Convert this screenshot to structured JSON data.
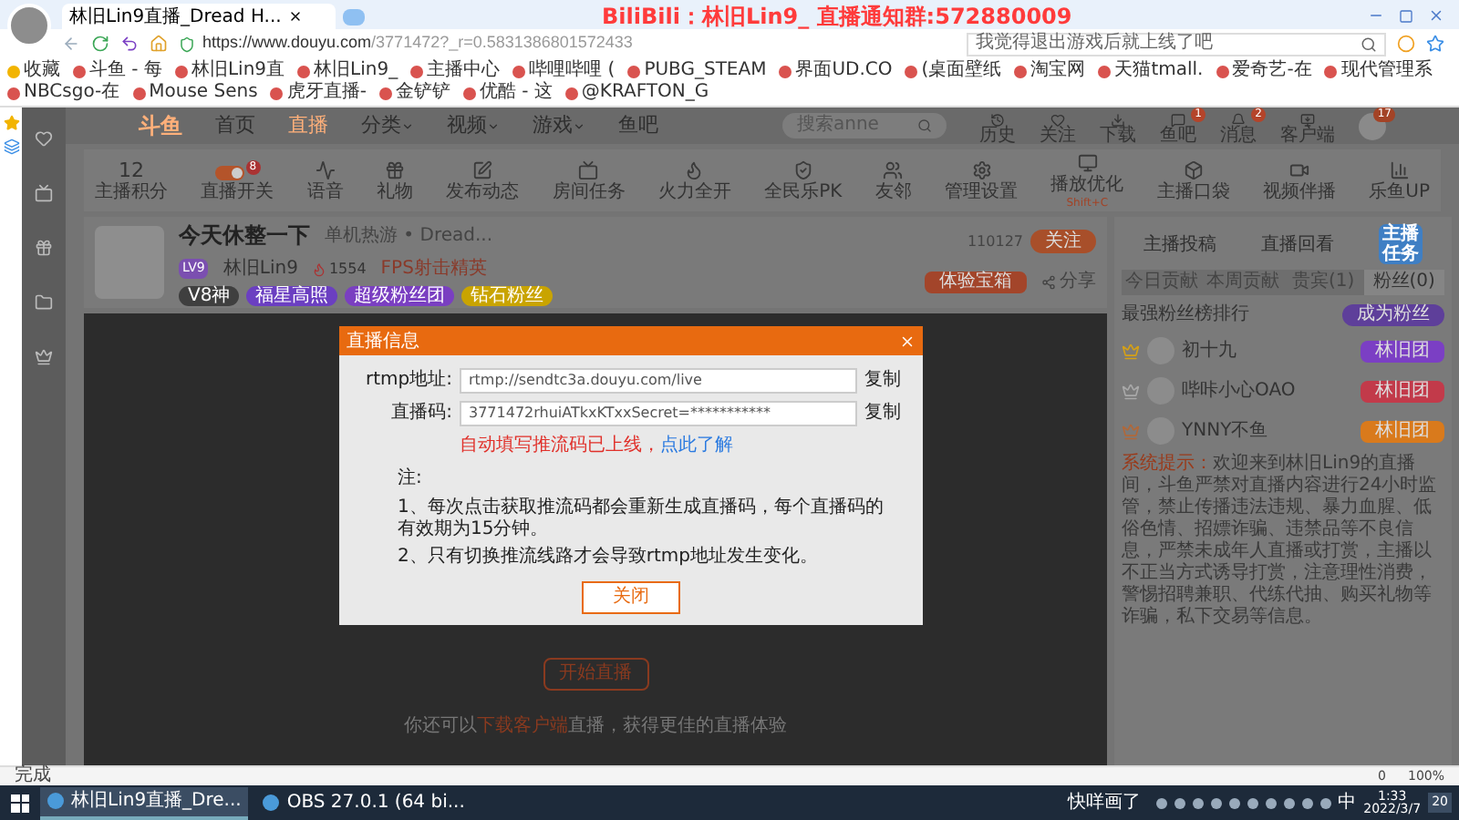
{
  "browser": {
    "tab_title": "林旧Lin9直播_Dread H...",
    "overlay_text": "BiliBili：林旧Lin9_  直播通知群:572880009",
    "url_host": "https://www.douyu.com",
    "url_path": "/3771472?_r=0.5831386801572433",
    "search_placeholder": "我觉得退出游戏后就上线了吧",
    "bookmarks": [
      "收藏",
      "斗鱼 - 每",
      "林旧Lin9直",
      "林旧Lin9_",
      "主播中心",
      "哔哩哔哩 (",
      "PUBG_STEAM",
      "界面UD.CO",
      "(桌面壁纸",
      "淘宝网",
      "天猫tmall.",
      "爱奇艺-在",
      "现代管理系",
      "NBCsgo-在",
      "Mouse Sens",
      "虎牙直播-",
      "金铲铲",
      "优酷 - 这",
      "@KRAFTON_G"
    ]
  },
  "site_nav": {
    "logo": "斗鱼",
    "items": [
      {
        "label": "首页",
        "selected": false,
        "dropdown": false
      },
      {
        "label": "直播",
        "selected": true,
        "dropdown": false
      },
      {
        "label": "分类",
        "selected": false,
        "dropdown": true
      },
      {
        "label": "视频",
        "selected": false,
        "dropdown": true
      },
      {
        "label": "游戏",
        "selected": false,
        "dropdown": true
      },
      {
        "label": "鱼吧",
        "selected": false,
        "dropdown": false
      }
    ],
    "search_placeholder": "搜索anne",
    "icons": [
      {
        "label": "历史"
      },
      {
        "label": "关注"
      },
      {
        "label": "下载"
      },
      {
        "label": "鱼吧",
        "badge": "1"
      },
      {
        "label": "消息",
        "badge": "2"
      },
      {
        "label": "客户端"
      }
    ],
    "avatar_badge": "17"
  },
  "toolbar": [
    {
      "kind": "count",
      "value": "12",
      "label": "主播积分"
    },
    {
      "kind": "toggle",
      "label": "直播开关",
      "on": true,
      "badge": "8"
    },
    {
      "kind": "icon",
      "label": "语音"
    },
    {
      "kind": "icon",
      "label": "礼物"
    },
    {
      "kind": "icon",
      "label": "发布动态"
    },
    {
      "kind": "icon",
      "label": "房间任务"
    },
    {
      "kind": "icon",
      "label": "火力全开"
    },
    {
      "kind": "icon",
      "label": "全民乐PK"
    },
    {
      "kind": "icon",
      "label": "友邻"
    },
    {
      "kind": "icon",
      "label": "管理设置"
    },
    {
      "kind": "icon",
      "label": "播放优化",
      "hint": "Shift+C"
    },
    {
      "kind": "icon",
      "label": "主播口袋"
    },
    {
      "kind": "icon",
      "label": "视频伴播"
    },
    {
      "kind": "icon",
      "label": "乐鱼UP"
    }
  ],
  "stream": {
    "title": "今天休整一下",
    "category": "单机热游 • Dread...",
    "streamer": "林旧Lin9",
    "level": "LV9",
    "heat": "1554",
    "honor": "FPS射击精英",
    "tags": [
      {
        "label": "V8神",
        "color": "#3f3f3f"
      },
      {
        "label": "福星高照",
        "color": "#6b3fc1"
      },
      {
        "label": "超级粉丝团",
        "color": "#7a3fc1"
      },
      {
        "label": "钻石粉丝",
        "color": "#c9a400"
      }
    ],
    "followers": "110127",
    "follow_button": "关注",
    "treasure": "体验宝箱",
    "share": "分享"
  },
  "video": {
    "start_button": "开始直播",
    "hint_before": "你还可以",
    "hint_link": "下载客户端",
    "hint_after": "直播，获得更佳的直播体验"
  },
  "modal": {
    "title": "直播信息",
    "rows": [
      {
        "label": "rtmp地址:",
        "value": "rtmp://sendtc3a.douyu.com/live",
        "action": "复制"
      },
      {
        "label": "直播码:",
        "value": "3771472rhuiATkxKTxxSecret=***********",
        "action": "复制"
      }
    ],
    "warning": "自动填写推流码已上线，",
    "warning_link": "点此了解",
    "note_title": "注:",
    "notes": [
      "1、每次点击获取推流码都会重新生成直播码，每个直播码的有效期为15分钟。",
      "2、只有切换推流线路才会导致rtmp地址发生变化。"
    ],
    "close_button": "关闭"
  },
  "right_panel": {
    "links": [
      "主播投稿",
      "直播回看"
    ],
    "tabs": [
      {
        "label": "今日贡献",
        "selected": false
      },
      {
        "label": "本周贡献",
        "selected": false
      },
      {
        "label": "贵宾(1)",
        "selected": false
      },
      {
        "label": "粉丝(0)",
        "selected": true
      }
    ],
    "fan_rank_title": "最强粉丝榜排行",
    "become_fan": "成为粉丝",
    "fans": [
      {
        "name": "初十九",
        "badge": "林旧团",
        "color": "#7b3fc4"
      },
      {
        "name": "哔咔小心OAO",
        "badge": "林旧团",
        "color": "#c23a4a"
      },
      {
        "name": "YNNY不鱼",
        "badge": "林旧团",
        "color": "#d97a1c"
      }
    ],
    "notice_label": "系统提示：",
    "notice": "欢迎来到林旧Lin9的直播间，斗鱼严禁对直播内容进行24小时监管，禁止传播违法违规、暴力血腥、低俗色情、招嫖诈骗、违禁品等不良信息，严禁未成年人直播或打赏，主播以不正当方式诱导打赏，注意理性消费，警惕招聘兼职、代练代抽、购买礼物等诈骗，私下交易等信息。",
    "task_art": "主播任务"
  },
  "status_bar": {
    "text": "完成",
    "count": "0",
    "zoom": "100%"
  },
  "taskbar": {
    "apps": [
      {
        "label": "林旧Lin9直播_Dre...",
        "selected": true
      },
      {
        "label": "OBS 27.0.1 (64 bi...",
        "selected": false
      }
    ],
    "tray_text": "快咩画了",
    "ime": "中",
    "time": "1:33",
    "date": "2022/3/7",
    "notifications": "20"
  }
}
